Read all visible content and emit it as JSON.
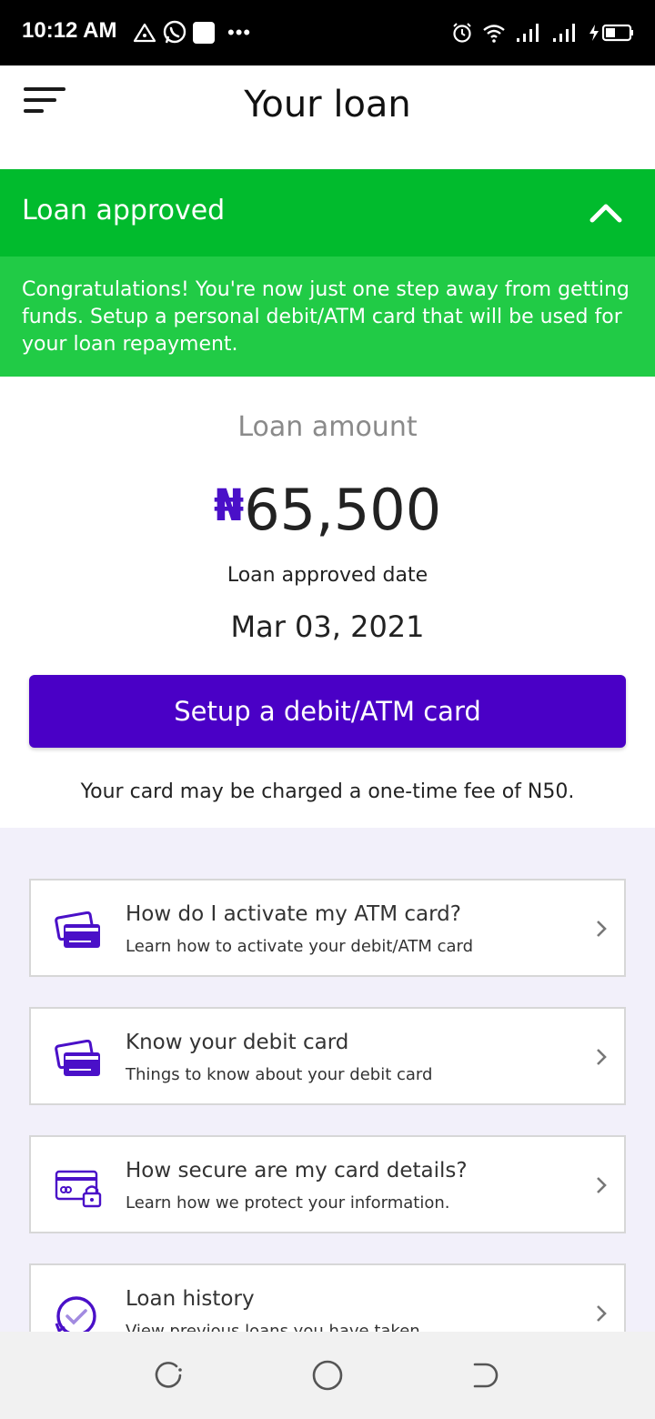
{
  "status_bar": {
    "time": "10:12 AM",
    "left_icons": [
      "alert-triangle-icon",
      "whatsapp-icon",
      "app-square-icon",
      "more-dots-icon"
    ],
    "dots": "•••",
    "right_icons": [
      "alarm-icon",
      "wifi-icon",
      "signal-icon",
      "signal-icon",
      "battery-charging-icon"
    ]
  },
  "header": {
    "title": "Your loan",
    "menu_icon": "menu-icon"
  },
  "banner": {
    "title": "Loan approved",
    "message": "Congratulations! You're now just one step away from getting funds. Setup a personal debit/ATM card that will be used for your loan repayment.",
    "collapse_icon": "chevron-up-icon",
    "header_color": "#01bb2d",
    "body_color": "#21cb46"
  },
  "loan": {
    "amount_label": "Loan amount",
    "currency_symbol": "₦",
    "amount": "65,500",
    "approved_date_label": "Loan approved date",
    "approved_date": "Mar 03, 2021",
    "accent_color": "#4a10c8"
  },
  "cta": {
    "label": "Setup a debit/ATM card",
    "color": "#4a00c6"
  },
  "fee_note": "Your card may be charged a one-time fee of N50.",
  "info_items": [
    {
      "title": "How do I activate my ATM card?",
      "subtitle": "Learn how to activate your debit/ATM card",
      "icon": "credit-cards-icon"
    },
    {
      "title": "Know your debit card",
      "subtitle": "Things to know about your debit card",
      "icon": "credit-cards-icon"
    },
    {
      "title": "How secure are my card details?",
      "subtitle": "Learn how we protect your information.",
      "icon": "card-lock-icon"
    },
    {
      "title": "Loan history",
      "subtitle": "View previous loans you have taken",
      "icon": "history-check-icon"
    }
  ],
  "nav": {
    "icons": [
      "recents-icon",
      "home-icon",
      "back-icon"
    ]
  }
}
